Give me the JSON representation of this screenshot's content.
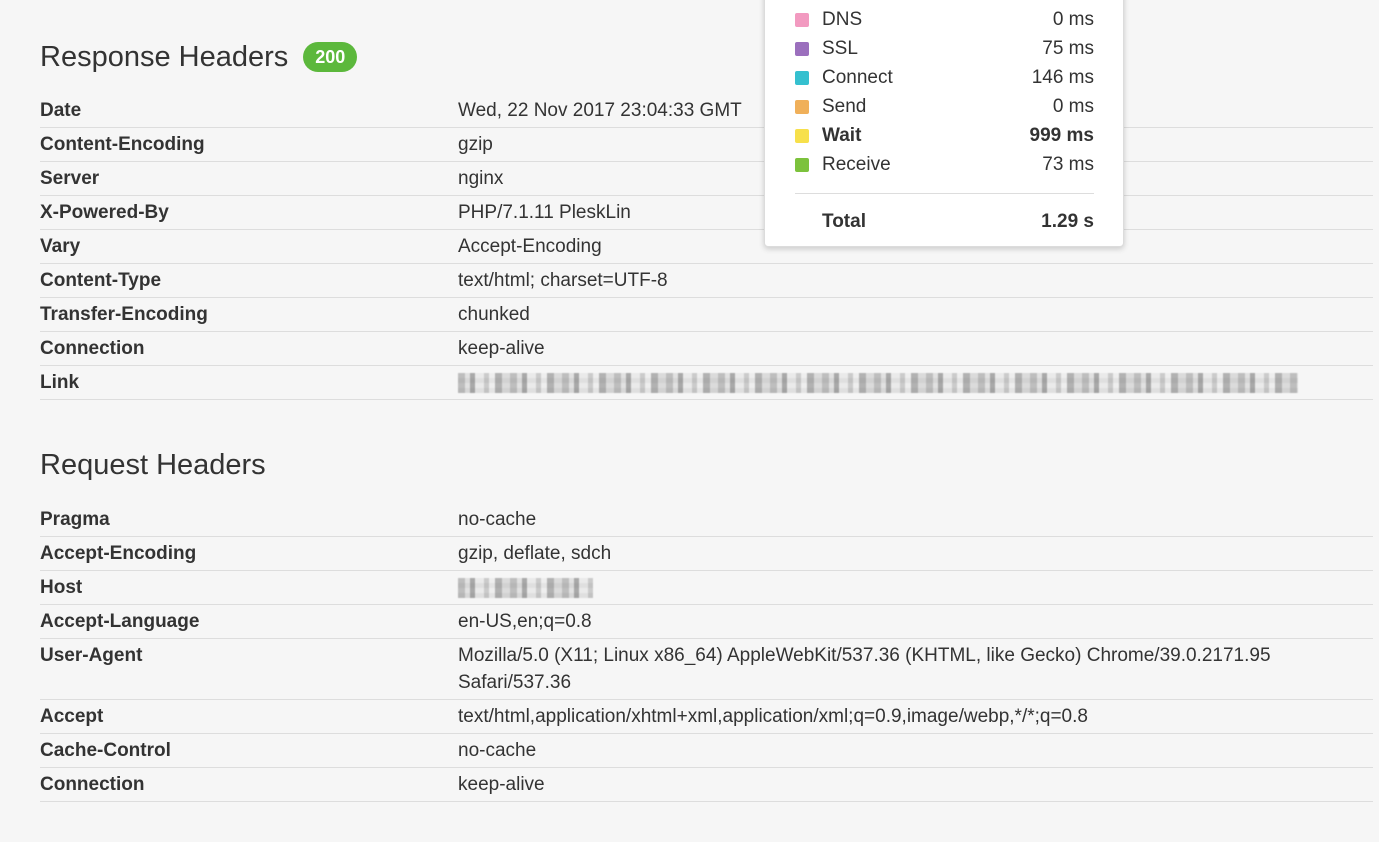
{
  "response": {
    "title": "Response Headers",
    "status_code": "200",
    "status_color": "#5cb83c",
    "rows": [
      {
        "key": "Date",
        "value": "Wed, 22 Nov 2017 23:04:33 GMT"
      },
      {
        "key": "Content-Encoding",
        "value": "gzip"
      },
      {
        "key": "Server",
        "value": "nginx"
      },
      {
        "key": "X-Powered-By",
        "value": "PHP/7.1.11 PleskLin"
      },
      {
        "key": "Vary",
        "value": "Accept-Encoding"
      },
      {
        "key": "Content-Type",
        "value": "text/html; charset=UTF-8"
      },
      {
        "key": "Transfer-Encoding",
        "value": "chunked"
      },
      {
        "key": "Connection",
        "value": "keep-alive"
      },
      {
        "key": "Link",
        "value": ""
      }
    ]
  },
  "request": {
    "title": "Request Headers",
    "rows": [
      {
        "key": "Pragma",
        "value": "no-cache"
      },
      {
        "key": "Accept-Encoding",
        "value": "gzip, deflate, sdch"
      },
      {
        "key": "Host",
        "value": ""
      },
      {
        "key": "Accept-Language",
        "value": "en-US,en;q=0.8"
      },
      {
        "key": "User-Agent",
        "value": "Mozilla/5.0 (X11; Linux x86_64) AppleWebKit/537.36 (KHTML, like Gecko) Chrome/39.0.2171.95 Safari/537.36"
      },
      {
        "key": "Accept",
        "value": "text/html,application/xhtml+xml,application/xml;q=0.9,image/webp,*/*;q=0.8"
      },
      {
        "key": "Cache-Control",
        "value": "no-cache"
      },
      {
        "key": "Connection",
        "value": "keep-alive"
      }
    ]
  },
  "timing": {
    "rows": [
      {
        "label": "DNS",
        "value": "0 ms",
        "color": "#f29ac0"
      },
      {
        "label": "SSL",
        "value": "75 ms",
        "color": "#9b6fbd"
      },
      {
        "label": "Connect",
        "value": "146 ms",
        "color": "#35c0cf"
      },
      {
        "label": "Send",
        "value": "0 ms",
        "color": "#f0b05a"
      },
      {
        "label": "Wait",
        "value": "999 ms",
        "color": "#f7e04b"
      },
      {
        "label": "Receive",
        "value": "73 ms",
        "color": "#7cc23c"
      }
    ],
    "total_label": "Total",
    "total_value": "1.29 s"
  }
}
